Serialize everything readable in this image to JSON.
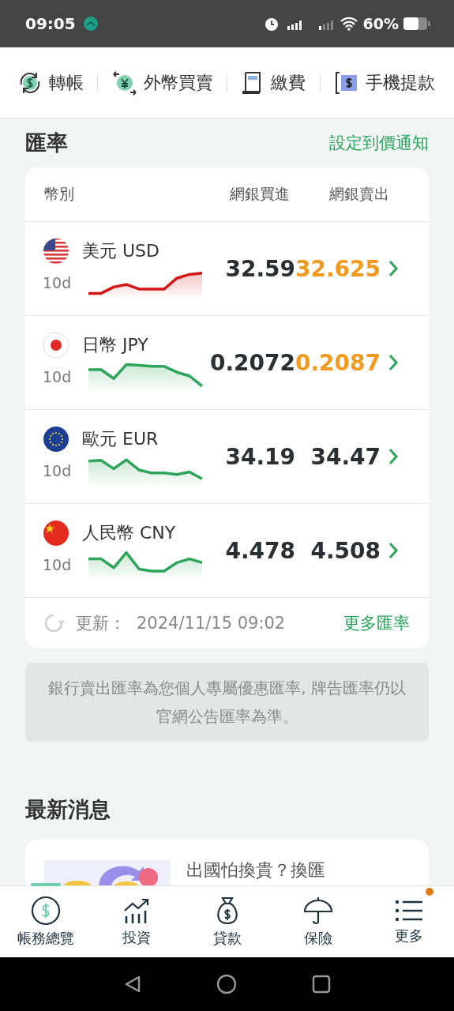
{
  "status_bar": {
    "time": "09:05",
    "battery": "60%"
  },
  "quick_links": [
    {
      "kind": "transfer",
      "label": "轉帳"
    },
    {
      "kind": "forex",
      "label": "外幣買賣"
    },
    {
      "kind": "bill",
      "label": "繳費"
    },
    {
      "kind": "withdraw",
      "label": "手機提款"
    }
  ],
  "rates": {
    "title": "匯率",
    "alert_link": "設定到價通知",
    "columns": [
      "幣別",
      "網銀買進",
      "網銀賣出"
    ],
    "rows": [
      {
        "kind": "us",
        "name": "美元 USD",
        "period": "10d",
        "color": "#d41616",
        "buy": "32.59",
        "sell": "32.625",
        "sell_highlight": true
      },
      {
        "kind": "jp",
        "name": "日幣 JPY",
        "period": "10d",
        "color": "#2ea55a",
        "buy": "0.2072",
        "sell": "0.2087",
        "sell_highlight": true
      },
      {
        "kind": "eu",
        "name": "歐元 EUR",
        "period": "10d",
        "color": "#2ea55a",
        "buy": "34.19",
        "sell": "34.47",
        "sell_highlight": false
      },
      {
        "kind": "cn",
        "name": "人民幣 CNY",
        "period": "10d",
        "color": "#2ea55a",
        "buy": "4.478",
        "sell": "4.508",
        "sell_highlight": false
      }
    ],
    "updated_label": "更新：",
    "updated_time": "2024/11/15 09:02",
    "more_link": "更多匯率"
  },
  "notice": "銀行賣出匯率為您個人專屬優惠匯率, 牌告匯率仍以官網公告匯率為準。",
  "news": {
    "title": "最新消息",
    "items": [
      {
        "kind": "picture",
        "headline": "出國怕換貴？換匯"
      }
    ]
  },
  "bottom_nav": [
    {
      "kind": "dollar",
      "label": "帳務總覽",
      "selected": true,
      "badge": false
    },
    {
      "kind": "chart",
      "label": "投資",
      "selected": false,
      "badge": false
    },
    {
      "kind": "bag",
      "label": "貸款",
      "selected": false,
      "badge": false
    },
    {
      "kind": "umbrella",
      "label": "保險",
      "selected": false,
      "badge": false
    },
    {
      "kind": "list",
      "label": "更多",
      "selected": false,
      "badge": true
    }
  ]
}
